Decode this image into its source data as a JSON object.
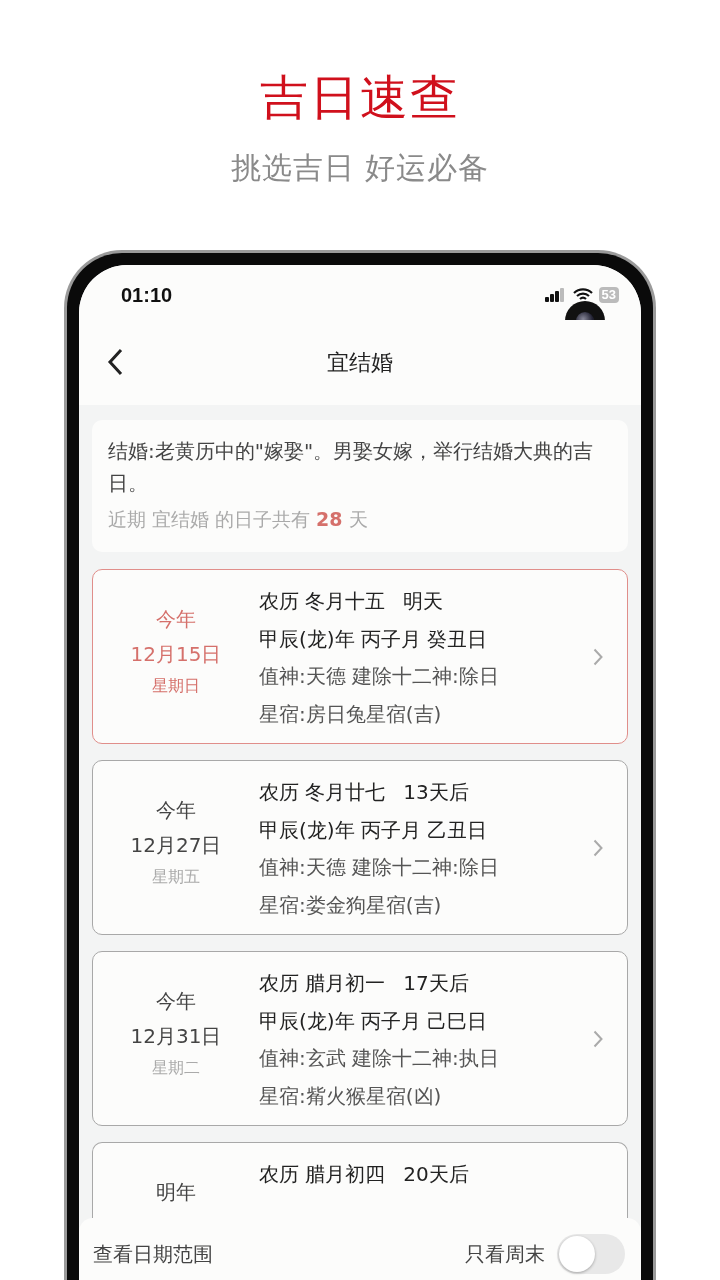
{
  "header": {
    "title": "吉日速查",
    "subtitle": "挑选吉日 好运必备"
  },
  "status_bar": {
    "time": "01:10",
    "battery": "53"
  },
  "nav": {
    "title": "宜结婚"
  },
  "intro": {
    "description": "结婚:老黄历中的\"嫁娶\"。男娶女嫁，举行结婚大典的吉日。",
    "summary_prefix": "近期 宜结婚 的日子共有",
    "count": "28",
    "summary_suffix": "天"
  },
  "days": [
    {
      "year": "今年",
      "date": "12月15日",
      "weekday": "星期日",
      "lunar": "农历 冬月十五",
      "relative": "明天",
      "ganzhi": "甲辰(龙)年 丙子月 癸丑日",
      "deity": "值神:天德 建除十二神:除日",
      "mansion": "星宿:房日兔星宿(吉)",
      "selected": true
    },
    {
      "year": "今年",
      "date": "12月27日",
      "weekday": "星期五",
      "lunar": "农历 冬月廿七",
      "relative": "13天后",
      "ganzhi": "甲辰(龙)年 丙子月 乙丑日",
      "deity": "值神:天德 建除十二神:除日",
      "mansion": "星宿:娄金狗星宿(吉)",
      "selected": false
    },
    {
      "year": "今年",
      "date": "12月31日",
      "weekday": "星期二",
      "lunar": "农历 腊月初一",
      "relative": "17天后",
      "ganzhi": "甲辰(龙)年 丙子月 己巳日",
      "deity": "值神:玄武 建除十二神:执日",
      "mansion": "星宿:觜火猴星宿(凶)",
      "selected": false
    },
    {
      "year": "明年",
      "lunar": "农历 腊月初四",
      "relative": "20天后",
      "selected": false
    }
  ],
  "bottom_bar": {
    "range_label": "查看日期范围",
    "weekend_label": "只看周末",
    "weekend_only": false
  }
}
